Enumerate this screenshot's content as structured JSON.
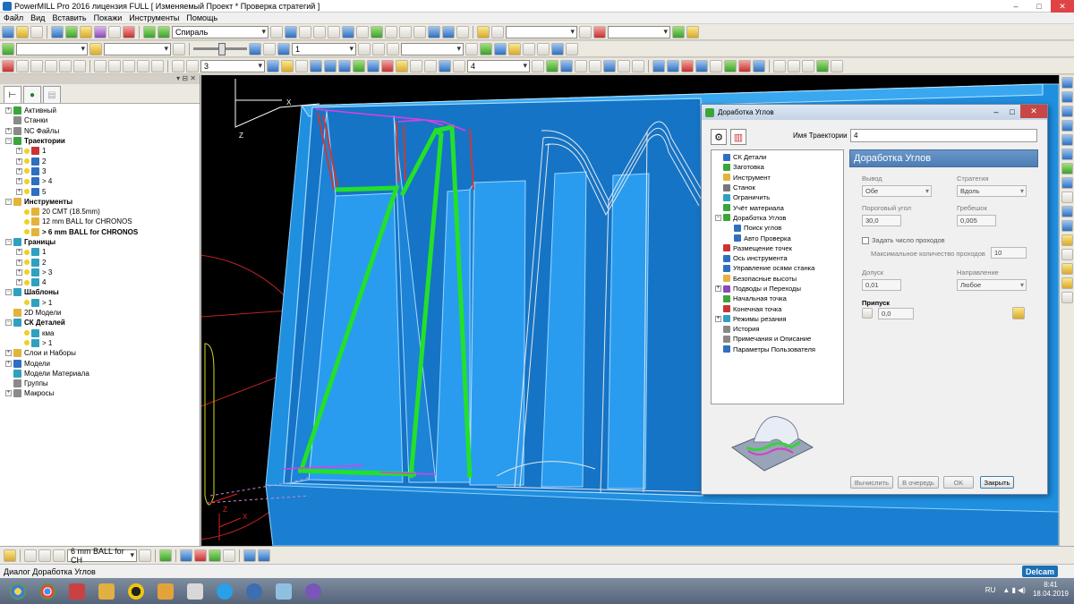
{
  "window": {
    "title": "PowerMILL Pro 2016 лицензия FULL   [ Изменяемый Проект * Проверка стратегий ]"
  },
  "menu": [
    "Файл",
    "Вид",
    "Вставить",
    "Покажи",
    "Инструменты",
    "Помощь"
  ],
  "toolbar": {
    "strategy_combo": "Спираль",
    "tool_combo_1": "",
    "combo_3": "3",
    "combo_1": "1",
    "combo_4": "4"
  },
  "explorer": {
    "items": [
      {
        "exp": "+",
        "icon": "g",
        "label": "Активный",
        "indent": 0
      },
      {
        "exp": "",
        "icon": "gr",
        "label": "Станки",
        "indent": 0
      },
      {
        "exp": "+",
        "icon": "gr",
        "label": "NC Файлы",
        "indent": 0
      },
      {
        "exp": "−",
        "icon": "g",
        "label": "Траектории",
        "indent": 0,
        "bold": true
      },
      {
        "exp": "+",
        "icon": "r",
        "label": "1",
        "indent": 1
      },
      {
        "exp": "+",
        "icon": "b",
        "label": "2",
        "indent": 1
      },
      {
        "exp": "+",
        "icon": "b",
        "label": "3",
        "indent": 1
      },
      {
        "exp": "+",
        "icon": "b",
        "label": "> 4",
        "indent": 1
      },
      {
        "exp": "+",
        "icon": "b",
        "label": "5",
        "indent": 1
      },
      {
        "exp": "−",
        "icon": "y",
        "label": "Инструменты",
        "indent": 0,
        "bold": true
      },
      {
        "exp": "",
        "icon": "y",
        "label": "20 CMT (18.5mm)",
        "indent": 1
      },
      {
        "exp": "",
        "icon": "y",
        "label": "12 mm BALL for CHRONOS",
        "indent": 1
      },
      {
        "exp": "",
        "icon": "y",
        "label": "> 6 mm BALL for CHRONOS",
        "indent": 1,
        "bold": true
      },
      {
        "exp": "−",
        "icon": "c",
        "label": "Границы",
        "indent": 0,
        "bold": true
      },
      {
        "exp": "+",
        "icon": "c",
        "label": "1",
        "indent": 1
      },
      {
        "exp": "+",
        "icon": "c",
        "label": "2",
        "indent": 1
      },
      {
        "exp": "+",
        "icon": "c",
        "label": "> 3",
        "indent": 1
      },
      {
        "exp": "+",
        "icon": "c",
        "label": "4",
        "indent": 1
      },
      {
        "exp": "−",
        "icon": "c",
        "label": "Шаблоны",
        "indent": 0,
        "bold": true
      },
      {
        "exp": "",
        "icon": "c",
        "label": "> 1",
        "indent": 1
      },
      {
        "exp": "",
        "icon": "y",
        "label": "2D Модели",
        "indent": 0
      },
      {
        "exp": "−",
        "icon": "c",
        "label": "СК Деталей",
        "indent": 0,
        "bold": true
      },
      {
        "exp": "",
        "icon": "c",
        "label": "кма",
        "indent": 1
      },
      {
        "exp": "",
        "icon": "c",
        "label": "> 1",
        "indent": 1
      },
      {
        "exp": "+",
        "icon": "y",
        "label": "Слои и Наборы",
        "indent": 0
      },
      {
        "exp": "+",
        "icon": "b",
        "label": "Модели",
        "indent": 0
      },
      {
        "exp": "",
        "icon": "c",
        "label": "Модели Материала",
        "indent": 0
      },
      {
        "exp": "",
        "icon": "gr",
        "label": "Группы",
        "indent": 0
      },
      {
        "exp": "+",
        "icon": "gr",
        "label": "Макросы",
        "indent": 0
      }
    ]
  },
  "dialog": {
    "title": "Доработка Углов",
    "name_label": "Имя Траектории",
    "name_value": "4",
    "tree": [
      {
        "exp": "",
        "icon": "#2f6fbf",
        "label": "СК Детали",
        "indent": 0
      },
      {
        "exp": "",
        "icon": "#3aa53a",
        "label": "Заготовка",
        "indent": 0
      },
      {
        "exp": "",
        "icon": "#e3b33c",
        "label": "Инструмент",
        "indent": 0
      },
      {
        "exp": "",
        "icon": "#777777",
        "label": "Станок",
        "indent": 0
      },
      {
        "exp": "",
        "icon": "#30a0c0",
        "label": "Ограничить",
        "indent": 0
      },
      {
        "exp": "",
        "icon": "#3aa53a",
        "label": "Учёт материала",
        "indent": 0
      },
      {
        "exp": "−",
        "icon": "#3aa53a",
        "label": "Доработка Углов",
        "indent": 0
      },
      {
        "exp": "",
        "icon": "#2f6fbf",
        "label": "Поиск углов",
        "indent": 1
      },
      {
        "exp": "",
        "icon": "#2f6fbf",
        "label": "Авто Проверка",
        "indent": 1
      },
      {
        "exp": "",
        "icon": "#cc3333",
        "label": "Размещение точек",
        "indent": 0
      },
      {
        "exp": "",
        "icon": "#2f6fbf",
        "label": "Ось инструмента",
        "indent": 0
      },
      {
        "exp": "",
        "icon": "#2f6fbf",
        "label": "Управление осями станка",
        "indent": 0
      },
      {
        "exp": "",
        "icon": "#e3b33c",
        "label": "Безопасные высоты",
        "indent": 0
      },
      {
        "exp": "+",
        "icon": "#8a48b8",
        "label": "Подводы и Переходы",
        "indent": 0
      },
      {
        "exp": "",
        "icon": "#3aa53a",
        "label": "Начальная точка",
        "indent": 0
      },
      {
        "exp": "",
        "icon": "#cc3333",
        "label": "Конечная точка",
        "indent": 0
      },
      {
        "exp": "+",
        "icon": "#30a0c0",
        "label": "Режимы резания",
        "indent": 0
      },
      {
        "exp": "",
        "icon": "#888888",
        "label": "История",
        "indent": 0
      },
      {
        "exp": "",
        "icon": "#888888",
        "label": "Примечания и Описание",
        "indent": 0
      },
      {
        "exp": "",
        "icon": "#2f6fbf",
        "label": "Параметры Пользователя",
        "indent": 0
      }
    ],
    "panel": {
      "header": "Доработка Углов",
      "output_label": "Вывод",
      "output_value": "Обе",
      "strategy_label": "Стратегия",
      "strategy_value": "Вдоль",
      "threshold_label": "Пороговый угол",
      "threshold_value": "30,0",
      "cusp_label": "Гребешок",
      "cusp_value": "0,005",
      "set_passes_label": "Задать число проходов",
      "max_passes_label": "Максимальное количество проходов",
      "max_passes_value": "10",
      "tolerance_label": "Допуск",
      "tolerance_value": "0,01",
      "direction_label": "Направление",
      "direction_value": "Любое",
      "allowance_label": "Припуск",
      "allowance_value": "0,0"
    },
    "buttons": {
      "calculate": "Вычислить",
      "queue": "В очередь",
      "ok": "OK",
      "close": "Закрыть"
    }
  },
  "bottom_toolbar": {
    "tool_combo": "6 mm BALL for CH"
  },
  "status": {
    "text": "Диалог Доработка Углов",
    "brand": "Delcam"
  },
  "taskbar": {
    "lang": "RU",
    "time": "8:41",
    "date": "18.04.2019"
  },
  "colors": {
    "part_blue": "#1f8fe0",
    "toolpath_green": "#23e02a",
    "toolpath_red": "#c83a3a",
    "toolpath_magenta": "#e23ce0",
    "dialog_header": "#4c7db4"
  }
}
